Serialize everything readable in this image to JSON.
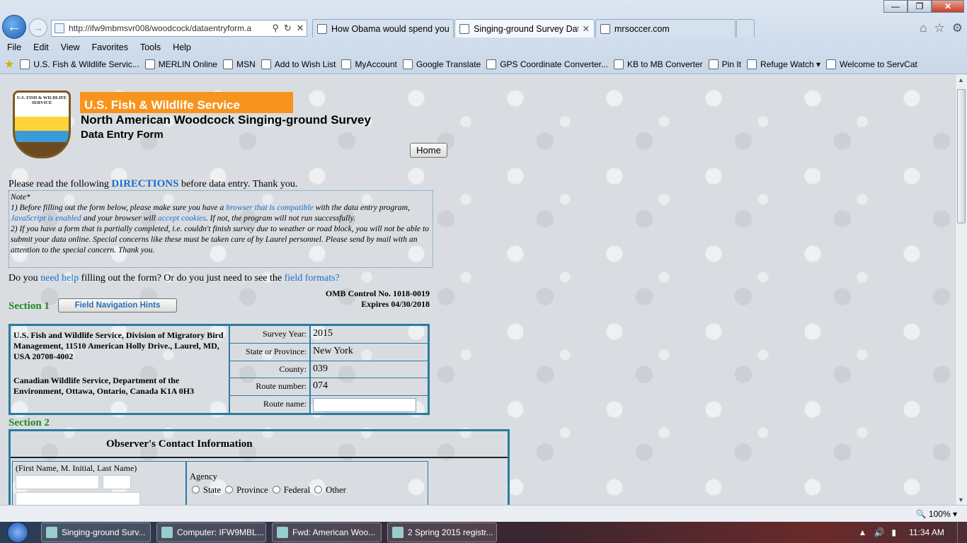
{
  "browser": {
    "address": "http://ifw9mbmsvr008/woodcock/dataentryform.a",
    "tabs": [
      {
        "label": "How Obama would spend you..."
      },
      {
        "label": "Singing-ground Survey Dat..."
      },
      {
        "label": "mrsoccer.com"
      }
    ],
    "menu": [
      "File",
      "Edit",
      "View",
      "Favorites",
      "Tools",
      "Help"
    ],
    "favorites": [
      "U.S. Fish & Wildlife Servic...",
      "MERLIN Online",
      "MSN",
      "Add to Wish List",
      "MyAccount",
      "Google Translate",
      "GPS Coordinate Converter...",
      "KB to MB Converter",
      "Pin It",
      "Refuge Watch",
      "Welcome to ServCat"
    ],
    "zoom": "100%"
  },
  "page": {
    "logo_text": "U.S. FISH & WILDLIFE SERVICE",
    "agency": "U.S. Fish & Wildlife Service",
    "title": "North American Woodcock Singing-ground Survey",
    "subtitle": "Data Entry Form",
    "home": "Home",
    "intro_pre": "Please read the following ",
    "intro_link": "DIRECTIONS",
    "intro_post": " before data entry.  Thank you.",
    "note": {
      "title": "Note*",
      "p1a": " 1) Before filling out the form below, please make sure you have a ",
      "p1_link1": "browser that is compatible",
      "p1b": " with the data entry program, ",
      "p1_link2": "JavaScript is enabled",
      "p1c": " and your browser will ",
      "p1_link3": "accept cookies",
      "p1d": ".  If not, the program will not run successfully.",
      "p2": "2)  If you have a form that is partially completed, i.e. couldn't finish survey due to weather or road block, you will not be able to submit your data online.  Special concerns like these must be taken care of by Laurel personnel.  Please send by mail with an attention to the special concern.  Thank you."
    },
    "help_pre": "Do you ",
    "help_link": "need help",
    "help_mid": " filling out the form?  Or do you just need to see the ",
    "help_link2": "field formats?",
    "omb": "OMB Control No. 1018-0019",
    "expires": "Expires 04/30/2018",
    "section1": "Section 1",
    "nav_hints": "Field Navigation Hints",
    "address_us": "U.S. Fish and Wildlife Service, Division of Migratory Bird Management, 11510 American Holly Drive., Laurel, MD, USA 20708-4002",
    "address_ca": "Canadian Wildlife Service, Department of the Environment, Ottawa, Ontario, Canada K1A 0H3",
    "fields": [
      {
        "label": "Survey Year:",
        "value": "2015"
      },
      {
        "label": "State or Province:",
        "value": "New York"
      },
      {
        "label": "County:",
        "value": "039"
      },
      {
        "label": "Route number:",
        "value": "074"
      }
    ],
    "route_name_label": "Route name:",
    "section2": "Section 2",
    "observer_header": "Observer's Contact Information",
    "name_label": "(First Name, M. Initial, Last Name)",
    "agency_label": "Agency",
    "agency_options": [
      "State",
      "Province",
      "Federal",
      "Other"
    ]
  },
  "taskbar": {
    "items": [
      "Singing-ground Surv...",
      "Computer: IFW9MBL...",
      "Fwd: American Woo...",
      "2 Spring 2015 registr..."
    ],
    "time": "11:34 AM"
  }
}
